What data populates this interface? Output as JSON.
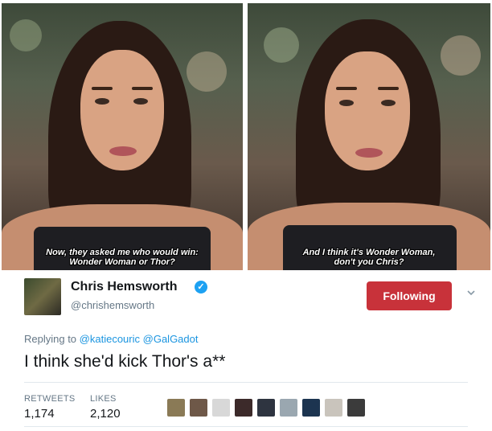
{
  "panels": {
    "left_caption": [
      "Now, they asked me who would win:",
      "Wonder Woman or Thor?"
    ],
    "right_caption": [
      "And I think it's Wonder Woman,",
      "don't you Chris?"
    ]
  },
  "tweet": {
    "name": "Chris Hemsworth",
    "handle": "@chrishemsworth",
    "verified_icon": "check-icon",
    "follow_label": "Following",
    "follow_color": "#c8323a",
    "replying_prefix": "Replying to",
    "mentions": [
      "@katiecouric",
      "@GalGadot"
    ],
    "text": "I think she'd kick Thor's a**",
    "stats": {
      "retweets_label": "RETWEETS",
      "retweets_value": "1,174",
      "likes_label": "LIKES",
      "likes_value": "2,120"
    },
    "liker_colors": [
      "#8a7a56",
      "#6e5848",
      "#d8d8d8",
      "#3c2a2a",
      "#2e3440",
      "#9aa7b0",
      "#1c3450",
      "#c9c4bc",
      "#3b3b3b"
    ]
  }
}
